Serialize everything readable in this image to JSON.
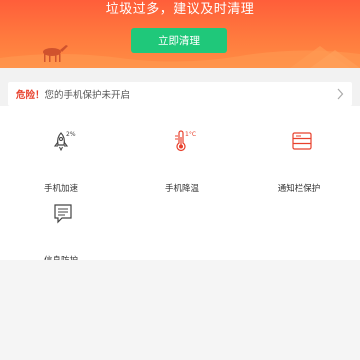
{
  "hero": {
    "title": "垃圾过多，建议及时清理",
    "clean_button": "立即清理",
    "colors": {
      "gradient_top": "#ff5e3a",
      "gradient_bottom": "#ff8d44",
      "button": "#1fc87a"
    }
  },
  "warning": {
    "label": "危险！",
    "message": "您的手机保护未开启",
    "accent": "#e8402c"
  },
  "features": [
    {
      "label": "手机加速",
      "icon": "rocket-icon",
      "badge": "2%"
    },
    {
      "label": "手机降温",
      "icon": "thermometer-icon",
      "badge": "1°C"
    },
    {
      "label": "通知栏保护",
      "icon": "notification-bar-icon"
    },
    {
      "label": "信息防护",
      "icon": "message-icon"
    }
  ]
}
